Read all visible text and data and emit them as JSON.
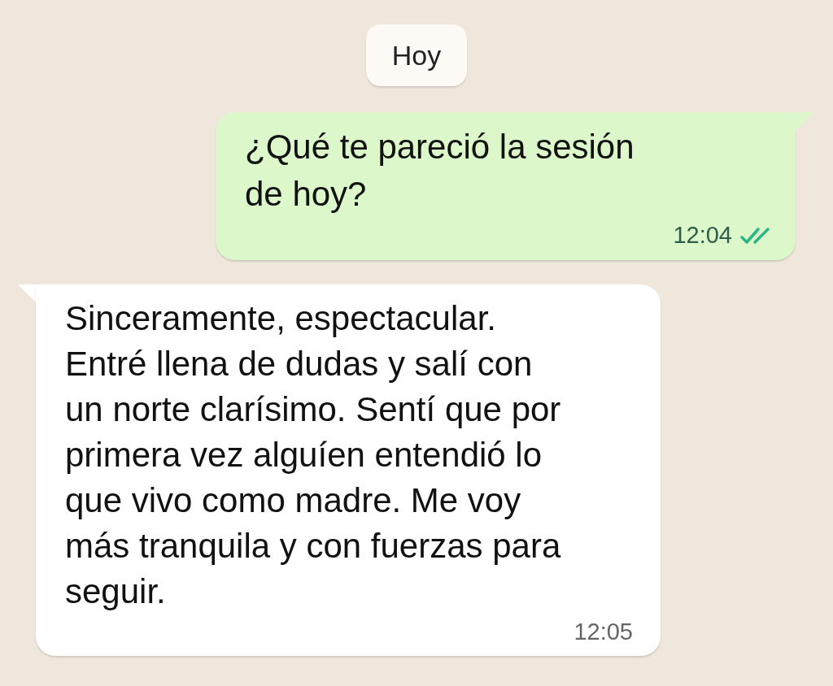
{
  "date_separator": "Hoy",
  "messages": [
    {
      "kind": "outgoing",
      "text": "¿Qué te pareció la sesión de hoy?",
      "time": "12:04",
      "read": true
    },
    {
      "kind": "incoming",
      "text": "Sinceramente, espectacular. Entré llena de dudas y salí con un norte clarísimo. Sentí que por primera vez alguíen entendió lo que vivo como madre. Me voy más tranquila y con fuerzas para seguir.",
      "time": "12:05"
    }
  ]
}
